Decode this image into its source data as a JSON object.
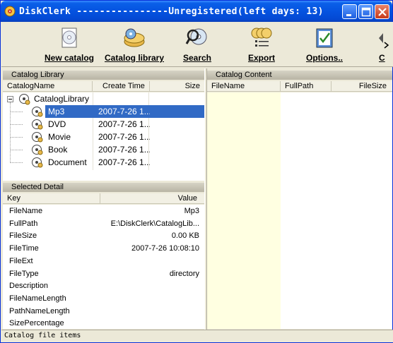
{
  "window": {
    "title": "DiskClerk ----------------Unregistered(left days: 13)"
  },
  "toolbar": {
    "new_catalog": "New catalog",
    "catalog_library": "Catalog library",
    "search": "Search",
    "export": "Export",
    "options": "Options..",
    "partial_next": "C"
  },
  "catalog_library": {
    "header": "Catalog Library",
    "columns": {
      "name": "CatalogName",
      "create_time": "Create Time",
      "size": "Size"
    },
    "root": "CatalogLibrary",
    "items": [
      {
        "name": "Mp3",
        "create_time": "2007-7-26 1...",
        "selected": true
      },
      {
        "name": "DVD",
        "create_time": "2007-7-26 1..."
      },
      {
        "name": "Movie",
        "create_time": "2007-7-26 1..."
      },
      {
        "name": "Book",
        "create_time": "2007-7-26 1..."
      },
      {
        "name": "Document",
        "create_time": "2007-7-26 1..."
      }
    ]
  },
  "selected_detail": {
    "header": "Selected Detail",
    "columns": {
      "key": "Key",
      "value": "Value"
    },
    "rows": [
      {
        "key": "FileName",
        "value": "Mp3"
      },
      {
        "key": "FullPath",
        "value": "E:\\DiskClerk\\CatalogLib..."
      },
      {
        "key": "FileSize",
        "value": "0.00 KB"
      },
      {
        "key": "FileTime",
        "value": "2007-7-26 10:08:10"
      },
      {
        "key": "FileExt",
        "value": ""
      },
      {
        "key": "FileType",
        "value": "directory"
      },
      {
        "key": "Description",
        "value": ""
      },
      {
        "key": "FileNameLength",
        "value": ""
      },
      {
        "key": "PathNameLength",
        "value": ""
      },
      {
        "key": "SizePercentage",
        "value": ""
      }
    ]
  },
  "catalog_content": {
    "header": "Catalog Content",
    "columns": {
      "filename": "FileName",
      "fullpath": "FullPath",
      "filesize": "FileSize"
    }
  },
  "status": {
    "text": "Catalog file items"
  },
  "colors": {
    "titlebar": "#0553E0",
    "selection": "#316AC5",
    "content_highlight": "#FFFFE1"
  }
}
